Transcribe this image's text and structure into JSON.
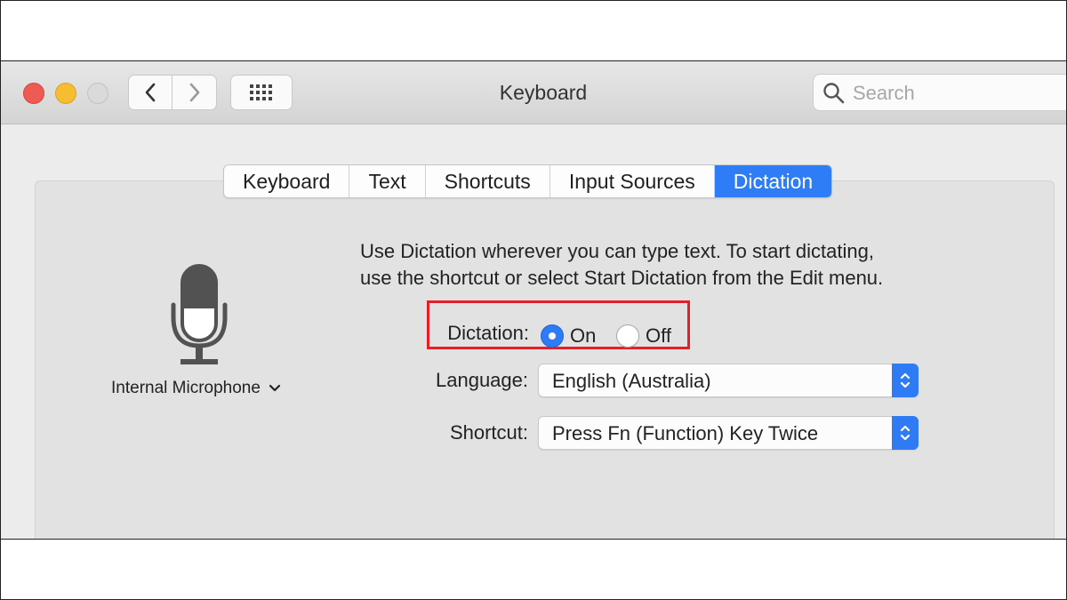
{
  "window": {
    "title": "Keyboard",
    "search_placeholder": "Search"
  },
  "icons": {
    "close": "close-icon",
    "minimize": "minimize-icon",
    "zoom": "zoom-icon",
    "back": "chevron-left-icon",
    "forward": "chevron-right-icon",
    "grid": "grid-icon",
    "search": "search-icon",
    "microphone": "microphone-icon"
  },
  "tabs": [
    {
      "label": "Keyboard"
    },
    {
      "label": "Text"
    },
    {
      "label": "Shortcuts"
    },
    {
      "label": "Input Sources"
    },
    {
      "label": "Dictation",
      "active": true
    }
  ],
  "microphone": {
    "selected": "Internal Microphone"
  },
  "description": {
    "line1": "Use Dictation wherever you can type text. To start dictating,",
    "line2": "use the shortcut or select Start Dictation from the Edit menu."
  },
  "dictation": {
    "label": "Dictation:",
    "options": [
      {
        "label": "On",
        "selected": true
      },
      {
        "label": "Off",
        "selected": false
      }
    ]
  },
  "language": {
    "label": "Language:",
    "value": "English (Australia)"
  },
  "shortcut": {
    "label": "Shortcut:",
    "value": "Press Fn (Function) Key Twice"
  },
  "colors": {
    "accent": "#2e7cf6",
    "highlight_box": "#e3202a",
    "close": "#ee5b54",
    "minimize": "#f5bd2f"
  }
}
